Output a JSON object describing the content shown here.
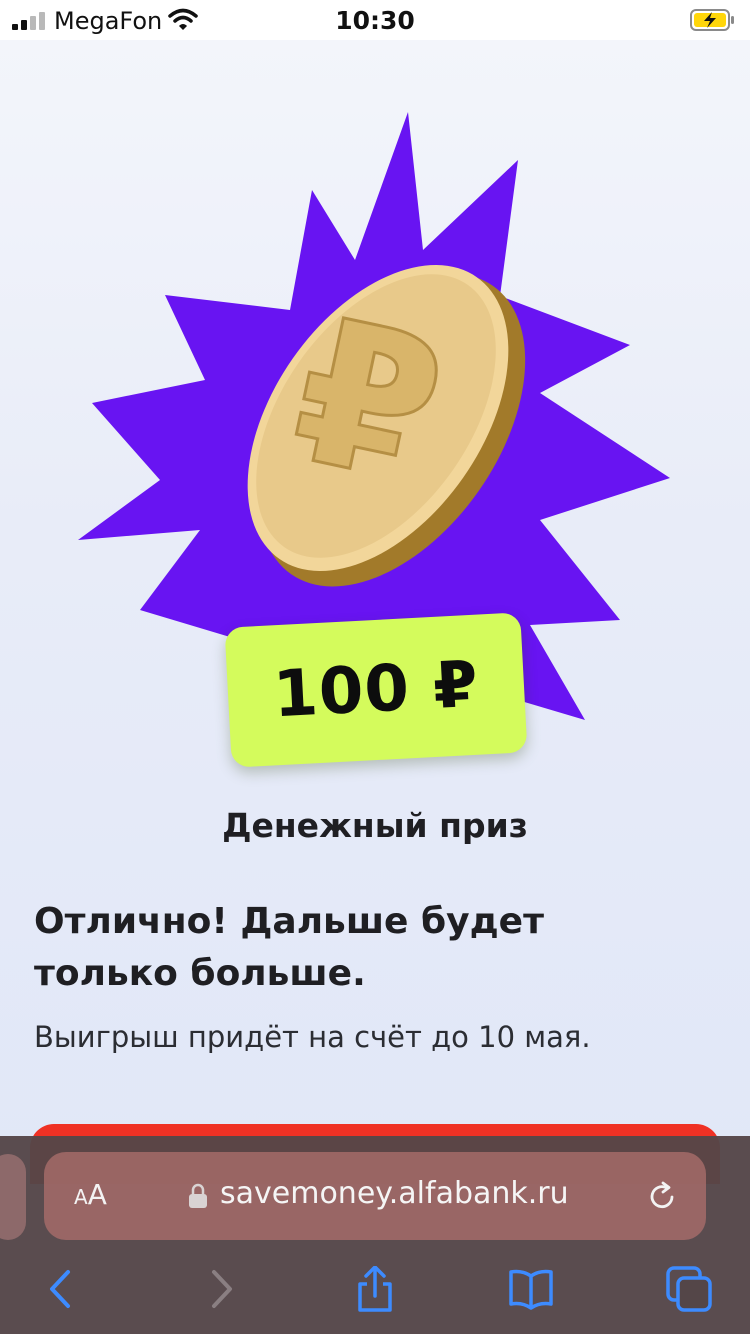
{
  "status_bar": {
    "carrier": "MegaFon",
    "time": "10:30",
    "icons": [
      "signal-icon",
      "wifi-icon",
      "battery-charging-icon"
    ]
  },
  "prize": {
    "amount": "100 ₽",
    "title": "Денежный приз",
    "illustration": [
      "starburst",
      "ruble-coin-icon"
    ],
    "colors": {
      "starburst": "#6814f2",
      "badge": "#d4fb5c",
      "coin": "#e8c98a"
    }
  },
  "message": {
    "headline": "Отлично! Дальше будет только больше.",
    "subtext": "Выигрыш придёт на счёт до 10 мая."
  },
  "cta": {
    "color": "#ef3124"
  },
  "browser": {
    "reader_label": "AA",
    "url": "savemoney.alfabank.ru",
    "toolbar_icons": [
      "back-icon",
      "forward-icon",
      "share-icon",
      "bookmarks-icon",
      "tabs-icon"
    ]
  }
}
